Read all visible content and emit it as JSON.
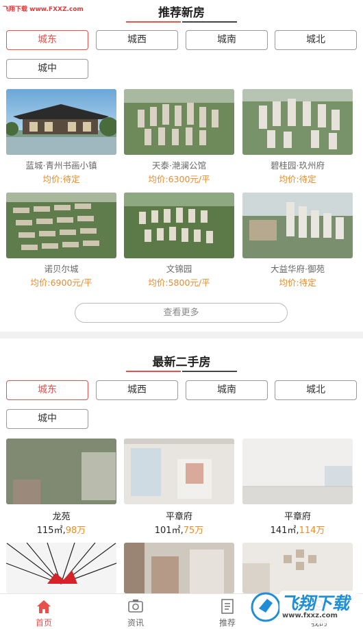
{
  "watermark_top": "飞翔下载 www.FXXZ.com",
  "new_houses": {
    "title": "推荐新房",
    "tabs": [
      "城东",
      "城西",
      "城南",
      "城北",
      "城中"
    ],
    "items": [
      {
        "name": "蓝城·青州书画小镇",
        "price": "均价:待定"
      },
      {
        "name": "天泰·滟澜公馆",
        "price": "均价:6300元/平"
      },
      {
        "name": "碧桂园·玖州府",
        "price": "均价:待定"
      },
      {
        "name": "诺贝尔城",
        "price": "均价:6900元/平"
      },
      {
        "name": "文锦园",
        "price": "均价:5800元/平"
      },
      {
        "name": "大益华府·御苑",
        "price": "均价:待定"
      }
    ],
    "more_label": "查看更多"
  },
  "second_hand": {
    "title": "最新二手房",
    "tabs": [
      "城东",
      "城西",
      "城南",
      "城北",
      "城中"
    ],
    "items": [
      {
        "name": "龙苑",
        "area": "115㎡,",
        "price": "98万"
      },
      {
        "name": "平章府",
        "area": "101㎡,",
        "price": "75万"
      },
      {
        "name": "平章府",
        "area": "141㎡,",
        "price": "114万"
      }
    ]
  },
  "nav": [
    {
      "label": "首页",
      "icon": "home-icon"
    },
    {
      "label": "资讯",
      "icon": "news-icon"
    },
    {
      "label": "推荐",
      "icon": "recommend-icon"
    },
    {
      "label": "我的",
      "icon": "user-icon"
    }
  ],
  "watermark_bottom": {
    "brand": "飞翔下载",
    "url": "www.fxxz.com"
  },
  "colors": {
    "accent": "#e8504b",
    "price": "#f08a24",
    "title_underline_dark": "#444444"
  }
}
